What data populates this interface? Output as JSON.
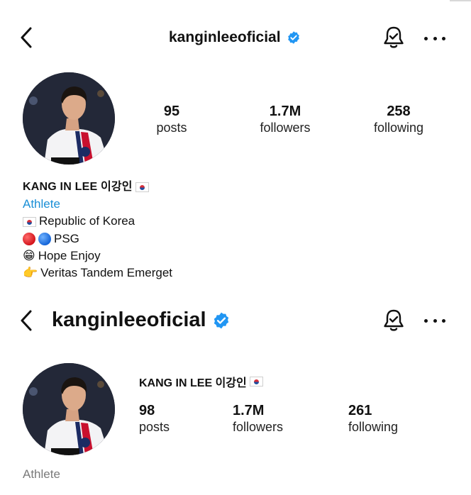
{
  "colors": {
    "verified_blue": "#2196f3",
    "category_blue": "#1a8fd6",
    "text": "#111111"
  },
  "header_top": {
    "title": "kanginleeoficial",
    "back_icon": "chevron-left-icon",
    "verified_icon": "verified-badge-icon",
    "bell_icon": "bell-icon",
    "more_icon": "more-horizontal-icon"
  },
  "profile_top": {
    "avatar_icon": "profile-photo",
    "stats": [
      {
        "value": "95",
        "label": "posts"
      },
      {
        "value": "1.7M",
        "label": "followers"
      },
      {
        "value": "258",
        "label": "following"
      }
    ]
  },
  "bio": {
    "name": "KANG IN LEE 이강인",
    "category": "Athlete",
    "lines": [
      {
        "text": "Republic of Korea"
      },
      {
        "text": "PSG"
      },
      {
        "emoji": "😁",
        "text": "Hope Enjoy"
      },
      {
        "emoji": "👉",
        "text": "Veritas Tandem Emerget"
      }
    ]
  },
  "header_bottom": {
    "title": "kanginleeoficial",
    "back_icon": "chevron-left-icon",
    "verified_icon": "verified-badge-icon",
    "bell_icon": "bell-icon",
    "more_icon": "more-horizontal-icon"
  },
  "profile_bottom": {
    "name": "KANG IN LEE 이강인",
    "category": "Athlete",
    "stats": [
      {
        "value": "98",
        "label": "posts"
      },
      {
        "value": "1.7M",
        "label": "followers"
      },
      {
        "value": "261",
        "label": "following"
      }
    ]
  }
}
